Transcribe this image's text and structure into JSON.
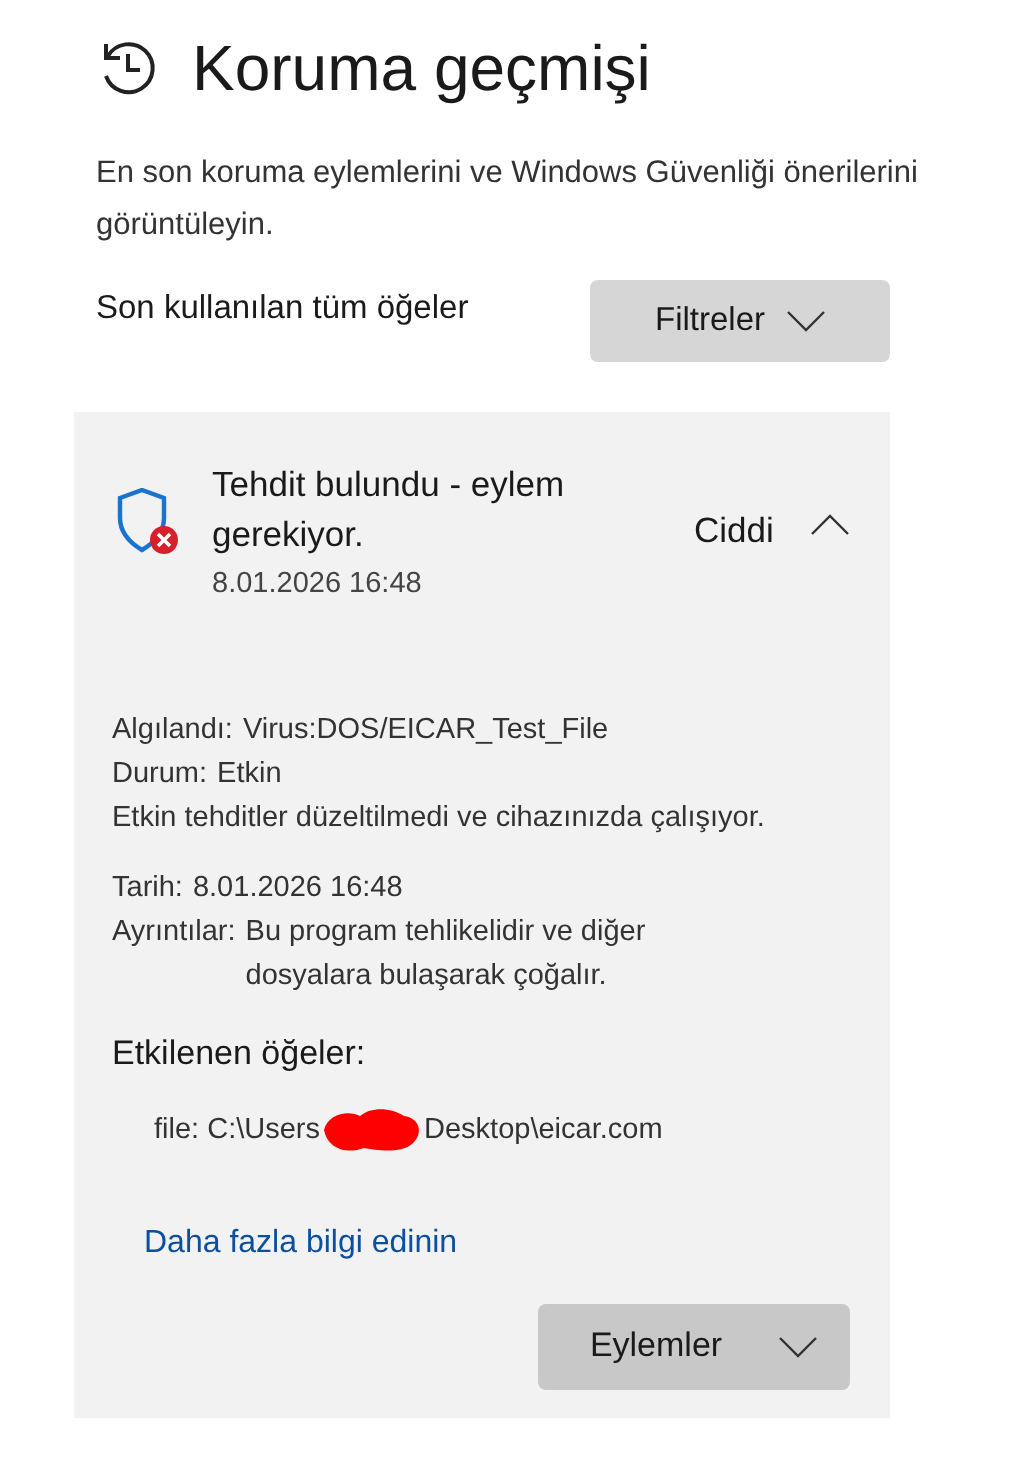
{
  "page": {
    "title": "Koruma geçmişi",
    "description": "En son koruma eylemlerini ve Windows Güvenliği önerilerini görüntüleyin."
  },
  "filter_row": {
    "label": "Son kullanılan tüm öğeler",
    "button": "Filtreler"
  },
  "threat": {
    "title": "Tehdit bulundu - eylem gerekiyor.",
    "date": "8.01.2026 16:48",
    "severity": "Ciddi",
    "expanded": true,
    "details_a": [
      {
        "label": "Algılandı:",
        "value": "Virus:DOS/EICAR_Test_File"
      },
      {
        "label": "Durum:",
        "value": "Etkin"
      }
    ],
    "status_note": "Etkin tehditler düzeltilmedi ve cihazınızda çalışıyor.",
    "details_b": [
      {
        "label": "Tarih:",
        "value": "8.01.2026 16:48"
      },
      {
        "label": "Ayrıntılar:",
        "value": "Bu program tehlikelidir ve diğer dosyalara bulaşarak çoğalır."
      }
    ],
    "affected_heading": "Etkilenen öğeler:",
    "affected_item": {
      "before": "file: C:\\Users",
      "after": "Desktop\\eicar.com"
    },
    "link": "Daha fazla bilgi edinin",
    "actions_button": "Eylemler"
  }
}
